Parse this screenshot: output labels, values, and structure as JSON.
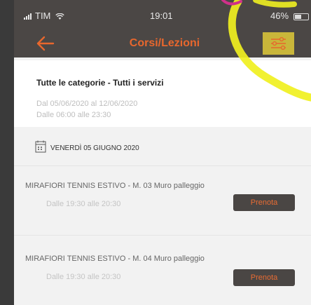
{
  "status_bar": {
    "carrier": "TIM",
    "time": "19:01",
    "battery": "46%"
  },
  "header": {
    "title": "Corsi/Lezioni",
    "back_icon": "arrow-left-icon",
    "filter_icon": "sliders-icon",
    "accent_color": "#e8672d",
    "bar_color": "#4b4745"
  },
  "filter": {
    "title": "Tutte le categorie - Tutti i servizi",
    "date_range": "Dal 05/06/2020 al 12/06/2020",
    "time_range": "Dalle 06:00 alle 23:30"
  },
  "day": {
    "label": "VENERDÌ 05 GIUGNO 2020"
  },
  "slots": [
    {
      "title": "MIRAFIORI TENNIS ESTIVO  - M. 03 Muro palleggio",
      "time": "Dalle 19:30 alle 20:30",
      "button": "Prenota"
    },
    {
      "title": "MIRAFIORI TENNIS ESTIVO  - M. 04 Muro palleggio",
      "time": "Dalle 19:30 alle 20:30",
      "button": "Prenota"
    }
  ]
}
